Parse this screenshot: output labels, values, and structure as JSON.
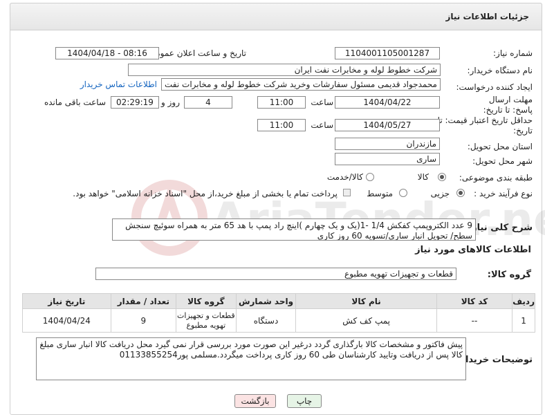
{
  "page": {
    "title": "جزئیات اطلاعات نیاز"
  },
  "labels": {
    "need_number": "شماره نیاز:",
    "announce_datetime": "تاریخ و ساعت اعلان عمومی:",
    "buyer_org": "نام دستگاه خریدار:",
    "creator": "ایجاد کننده درخواست:",
    "reply_deadline": "مهلت ارسال پاسخ: تا تاریخ:",
    "price_validity": "حداقل تاریخ اعتبار قیمت: تا تاریخ:",
    "time": "ساعت",
    "day_and": "روز و",
    "remaining": "ساعت باقی مانده",
    "province": "استان محل تحویل:",
    "city": "شهر محل تحویل:",
    "category": "طبقه بندی موضوعی:",
    "purchase_type": "نوع فرآیند خرید :",
    "summary": "شرح کلی نیاز:",
    "goods_info": "اطلاعات کالاهای مورد نیاز",
    "goods_group": "گروه کالا:",
    "buyer_notes": "توضیحات خریدار:"
  },
  "values": {
    "need_number": "1104001105001287",
    "announce_datetime": "1404/04/18 - 08:16",
    "buyer_org": "شرکت خطوط لوله و مخابرات نفت ایران",
    "creator": "محمدجواد قدیمی مسئول سفارشات وخرید شرکت خطوط لوله و مخابرات نفت ای",
    "contact_link": "اطلاعات تماس خریدار",
    "reply_date": "1404/04/22",
    "reply_time": "11:00",
    "days": "4",
    "remaining_time": "02:29:19",
    "price_date": "1404/05/27",
    "price_time": "11:00",
    "province": "مازندران",
    "city": "ساری",
    "summary": "9 عدد الکتروپمپ کفکش 1/4 -1(یک و یک چهارم )اینچ راد پمپ با هد 65 متر به همراه سوئیچ سنجش سطح/ تحویل انبار ساری/تسویه 60 روز کاری",
    "goods_group": "قطعات و تجهیزات تهویه مطبوع",
    "buyer_notes": "پیش فاکتور و مشخصات کالا بارگذاری گردد درغیر این صورت مورد بررسی قرار نمی گیرد محل دریافت کالا انبار ساری مبلغ کالا پس از دریافت وتایید کارشناسان طی 60 روز کاری پرداخت میگردد.مسلمی پور01133855254"
  },
  "category_options": {
    "goods": "کالا",
    "goods_service": "کالا/خدمت"
  },
  "purchase_options": {
    "partial": "جزیی",
    "medium": "متوسط",
    "treasury_note": "پرداخت تمام یا بخشی از مبلغ خرید،از محل \"اسناد خزانه اسلامی\" خواهد بود."
  },
  "table": {
    "headers": [
      "ردیف",
      "کد کالا",
      "نام کالا",
      "واحد شمارش",
      "گروه کالا",
      "تعداد / مقدار",
      "تاریخ نیاز"
    ],
    "rows": [
      {
        "row": "1",
        "code": "--",
        "name": "پمپ کف کش",
        "unit": "دستگاه",
        "group": "قطعات و تجهیزات تهویه مطبوع",
        "qty": "9",
        "date": "1404/04/24"
      }
    ]
  },
  "buttons": {
    "print": "چاپ",
    "back": "بازگشت"
  },
  "colors": {
    "link": "#1565c0",
    "back_button_bg": "#fbe3e3",
    "print_button_bg": "#e6f4e6"
  },
  "watermark": {
    "text": "AriaTender.net"
  }
}
